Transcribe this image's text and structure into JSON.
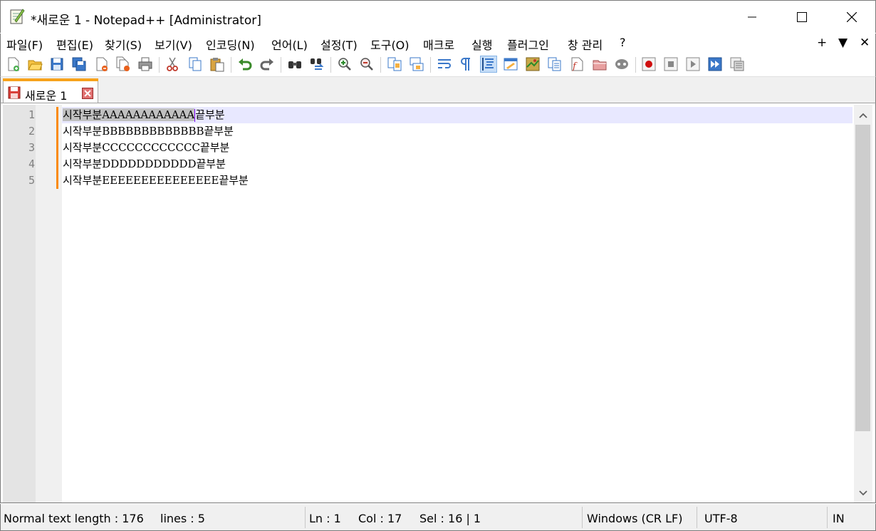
{
  "window": {
    "title": "*새로운 1 - Notepad++ [Administrator]",
    "minimize_glyph": "—",
    "maximize_glyph": "☐",
    "close_glyph": "✕"
  },
  "menu": {
    "items": [
      "파일(F)",
      "편집(E)",
      "찾기(S)",
      "보기(V)",
      "인코딩(N)",
      "언어(L)",
      "설정(T)",
      "도구(O)",
      "매크로",
      "실행",
      "플러그인",
      "창 관리",
      "?"
    ],
    "right_plus": "+",
    "right_down": "▼",
    "right_close": "✕"
  },
  "toolbar": {
    "icons": [
      "new-file-icon",
      "open-file-icon",
      "save-icon",
      "save-all-icon",
      "close-icon",
      "close-all-icon",
      "print-icon",
      "cut-icon",
      "copy-icon",
      "paste-icon",
      "undo-icon",
      "redo-icon",
      "find-icon",
      "replace-icon",
      "zoom-in-icon",
      "zoom-out-icon",
      "sync-vertical-icon",
      "sync-horizontal-icon",
      "word-wrap-icon",
      "show-all-chars-icon",
      "indent-guide-icon",
      "user-language-icon",
      "document-map-icon",
      "document-list-icon",
      "function-list-icon",
      "folder-as-workspace-icon",
      "monitoring-icon",
      "record-macro-icon",
      "stop-macro-icon",
      "play-macro-icon",
      "run-macro-multiple-icon",
      "save-macro-icon"
    ],
    "active_icon": "indent-guide-icon"
  },
  "tabs": [
    {
      "label": "새로운 1",
      "modified": true
    }
  ],
  "editor": {
    "line_numbers": [
      "1",
      "2",
      "3",
      "4",
      "5"
    ],
    "lines": [
      {
        "selected": "시작부분AAAAAAAAAAAA",
        "rest": "끝부분"
      },
      {
        "selected": "",
        "rest": "시작부분BBBBBBBBBBBBB끝부분"
      },
      {
        "selected": "",
        "rest": "시작부분CCCCCCCCCCCC끝부분"
      },
      {
        "selected": "",
        "rest": "시작부분DDDDDDDDDDD끝부분"
      },
      {
        "selected": "",
        "rest": "시작부분EEEEEEEEEEEEEEE끝부분"
      }
    ],
    "scroll_up_glyph": "︿",
    "scroll_down_glyph": "﹀"
  },
  "status": {
    "length": "Normal text length : 176",
    "lines": "lines : 5",
    "ln": "Ln : 1",
    "col": "Col : 17",
    "sel": "Sel : 16 | 1",
    "eol": "Windows (CR LF)",
    "encoding": "UTF-8",
    "mode": "IN"
  },
  "colors": {
    "tab_accent": "#f7a21b",
    "change_marker": "#fa8a0a",
    "caret": "#8000ff",
    "caret_line": "#e8e8ff",
    "selection": "#c0c0c0"
  }
}
